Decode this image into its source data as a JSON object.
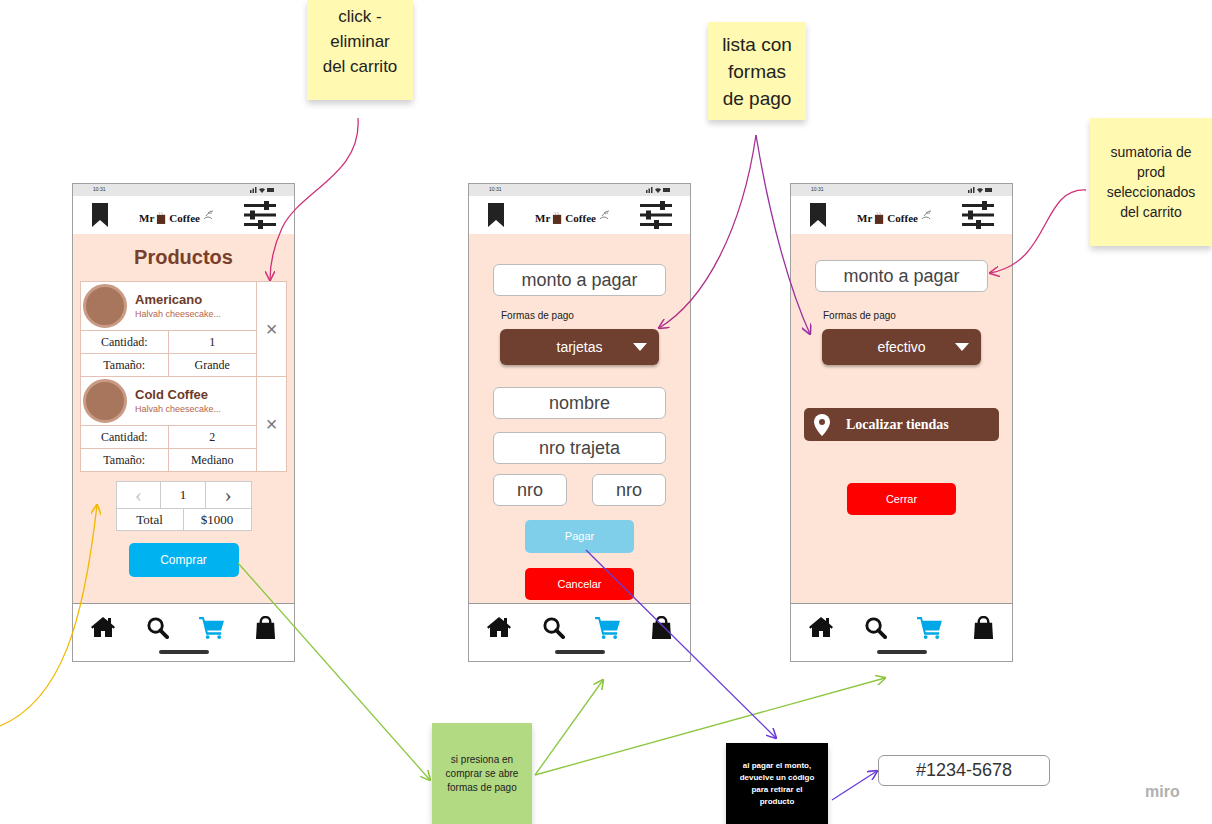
{
  "canvas": {
    "watermark": "miro"
  },
  "notes": [
    {
      "text": "click - eliminar del carrito",
      "color": "#fff9b1"
    },
    {
      "text": "lista con formas de pago",
      "color": "#fff9b1"
    },
    {
      "text": "sumatoria de prod seleccionados del carrito",
      "color": "#fff9b1"
    },
    {
      "text": "si presiona en comprar se abre formas de pago",
      "color": "#b2da82"
    },
    {
      "text": "al pagar el monto, devuelve un código para retirar el producto",
      "color": "#000000"
    }
  ],
  "code_box": {
    "text": "#1234-5678"
  },
  "phones": [
    {
      "kind": "cart",
      "status_time": "10:31",
      "logo_left": "Mr",
      "logo_right": "Coffee",
      "nav": [
        {
          "selected": false
        },
        {
          "selected": false
        },
        {
          "selected": true
        },
        {
          "selected": false
        }
      ],
      "title": "Productos",
      "items": [
        {
          "name": "Americano",
          "description": "Halvah cheesecake...",
          "remove": "×",
          "quantity_label": "Cantidad:",
          "quantity": "1",
          "size_label": "Tamaño:",
          "size": "Grande"
        },
        {
          "name": "Cold Coffee",
          "description": "Halvah cheesecake...",
          "remove": "×",
          "quantity_label": "Cantidad:",
          "quantity": "2",
          "size_label": "Tamaño:",
          "size": "Mediano"
        }
      ],
      "pager": {
        "prev": "‹",
        "prev_disabled": true,
        "page": "1",
        "next": "›",
        "next_disabled": false
      },
      "total_label": "Total",
      "total": "$1000",
      "button": "Comprar"
    },
    {
      "kind": "card_payment",
      "status_time": "10:31",
      "logo_left": "Mr",
      "logo_right": "Coffee",
      "nav": [
        {
          "selected": false
        },
        {
          "selected": false
        },
        {
          "selected": true
        },
        {
          "selected": false
        }
      ],
      "amount": "monto a pagar",
      "method_label": "Formas de pago",
      "method": "tarjetas",
      "fields": [
        "nombre",
        "nro trajeta"
      ],
      "small_fields": [
        "nro",
        "nro"
      ],
      "pay": {
        "label": "Pagar",
        "disabled": true
      },
      "cancel": "Cancelar"
    },
    {
      "kind": "cash_payment",
      "status_time": "10:31",
      "logo_left": "Mr",
      "logo_right": "Coffee",
      "nav": [
        {
          "selected": false
        },
        {
          "selected": false
        },
        {
          "selected": true
        },
        {
          "selected": false
        }
      ],
      "amount": "monto a pagar",
      "method_label": "Formas de pago",
      "method": "efectivo",
      "locate": "Localizar tiendas",
      "close": "Cerrar"
    }
  ]
}
